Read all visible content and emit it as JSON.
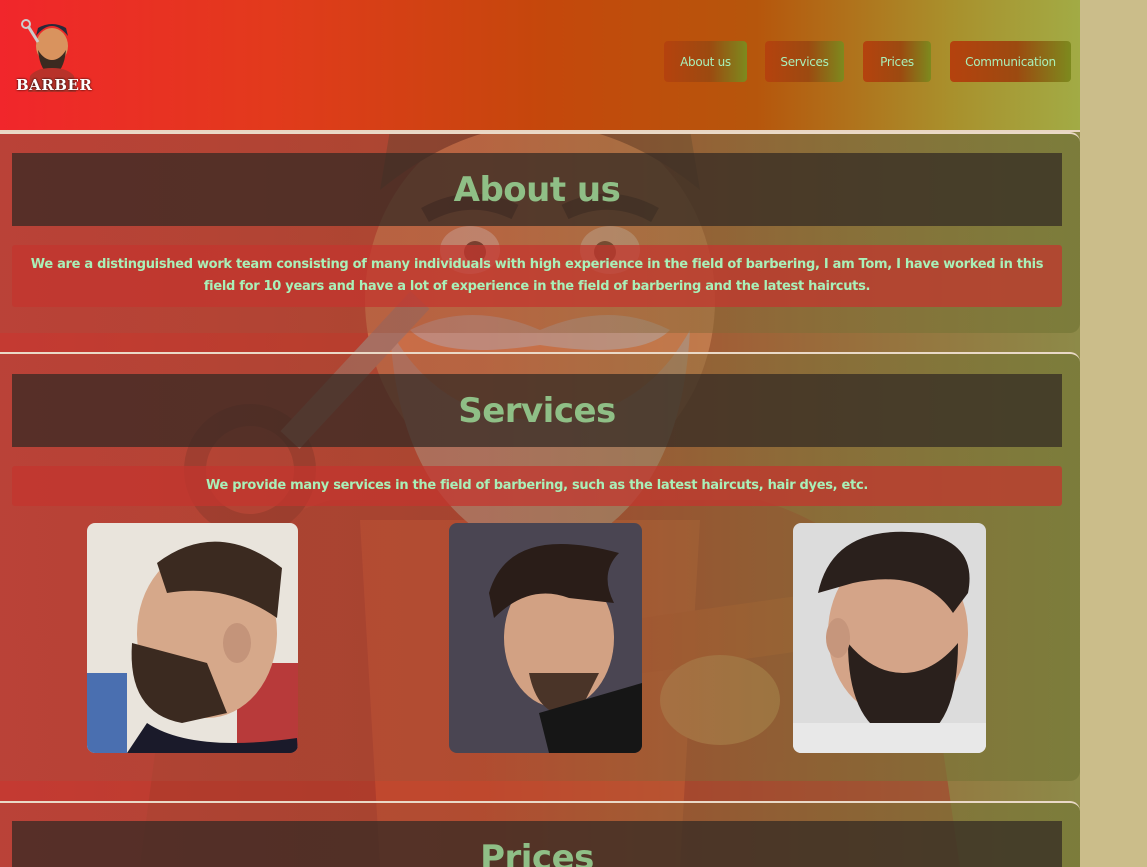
{
  "logo": {
    "text": "BARBER",
    "icon": "barber-mascot-logo"
  },
  "nav": [
    {
      "label": "About us"
    },
    {
      "label": "Services"
    },
    {
      "label": "Prices"
    },
    {
      "label": "Communication"
    }
  ],
  "about": {
    "title": "About us",
    "text": "We are a distinguished work team consisting of many individuals with high experience in the field of barbering, I am Tom, I have worked in this field for 10 years and have a lot of experience in the field of barbering and the latest haircuts."
  },
  "services": {
    "title": "Services",
    "text": "We provide many services in the field of barbering, such as the latest haircuts, hair dyes, etc.",
    "photos": [
      {
        "icon": "haircut-side-fade-photo"
      },
      {
        "icon": "haircut-pompadour-photo"
      },
      {
        "icon": "haircut-quiff-beard-photo"
      }
    ]
  },
  "prices": {
    "title": "Prices"
  },
  "colors": {
    "header_start": "#f1262b",
    "header_end": "#a2ab45",
    "accent_text": "#a9f0b8",
    "title_text": "#8fbf86",
    "side_background": "#cbbd8a"
  }
}
